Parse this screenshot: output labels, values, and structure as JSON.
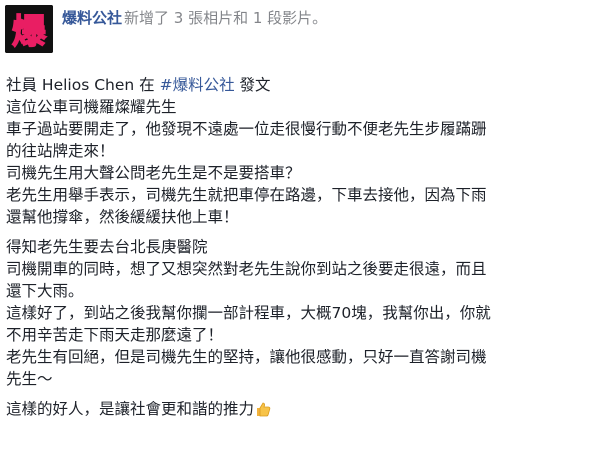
{
  "header": {
    "page_name": "爆料公社",
    "action": "新增了 3 張相片和 1 段影片。",
    "avatar_text": "爆",
    "avatar_bg": "#111111",
    "avatar_color": "#f4e04d"
  },
  "body": {
    "intro_prefix": "社員 Helios Chen 在 ",
    "hashtag": "#爆料公社",
    "intro_suffix": " 發文",
    "lines_1": [
      "這位公車司機羅燦耀先生",
      "車子過站要開走了，他發現不遠處一位走很慢行動不便老先生步履蹣跚",
      "的往站牌走來！",
      "司機先生用大聲公問老先生是不是要搭車？",
      "老先生用舉手表示，司機先生就把車停在路邊，下車去接他，因為下雨",
      "還幫他撐傘，然後緩緩扶他上車！"
    ],
    "lines_2": [
      "得知老先生要去台北長庚醫院",
      "司機開車的同時，想了又想突然對老先生說你到站之後要走很遠，而且",
      "還下大雨。",
      "這樣好了，到站之後我幫你攔一部計程車，大概70塊，我幫你出，你就",
      "不用辛苦走下雨天走那麼遠了！",
      "老先生有回絕，但是司機先生的堅持，讓他很感動，只好一直答謝司機",
      "先生～"
    ],
    "closing": "這樣的好人，是讓社會更和諧的推力",
    "closing_emoji": "thumbs-up-icon"
  },
  "colors": {
    "link": "#365899",
    "text": "#1d2129"
  }
}
